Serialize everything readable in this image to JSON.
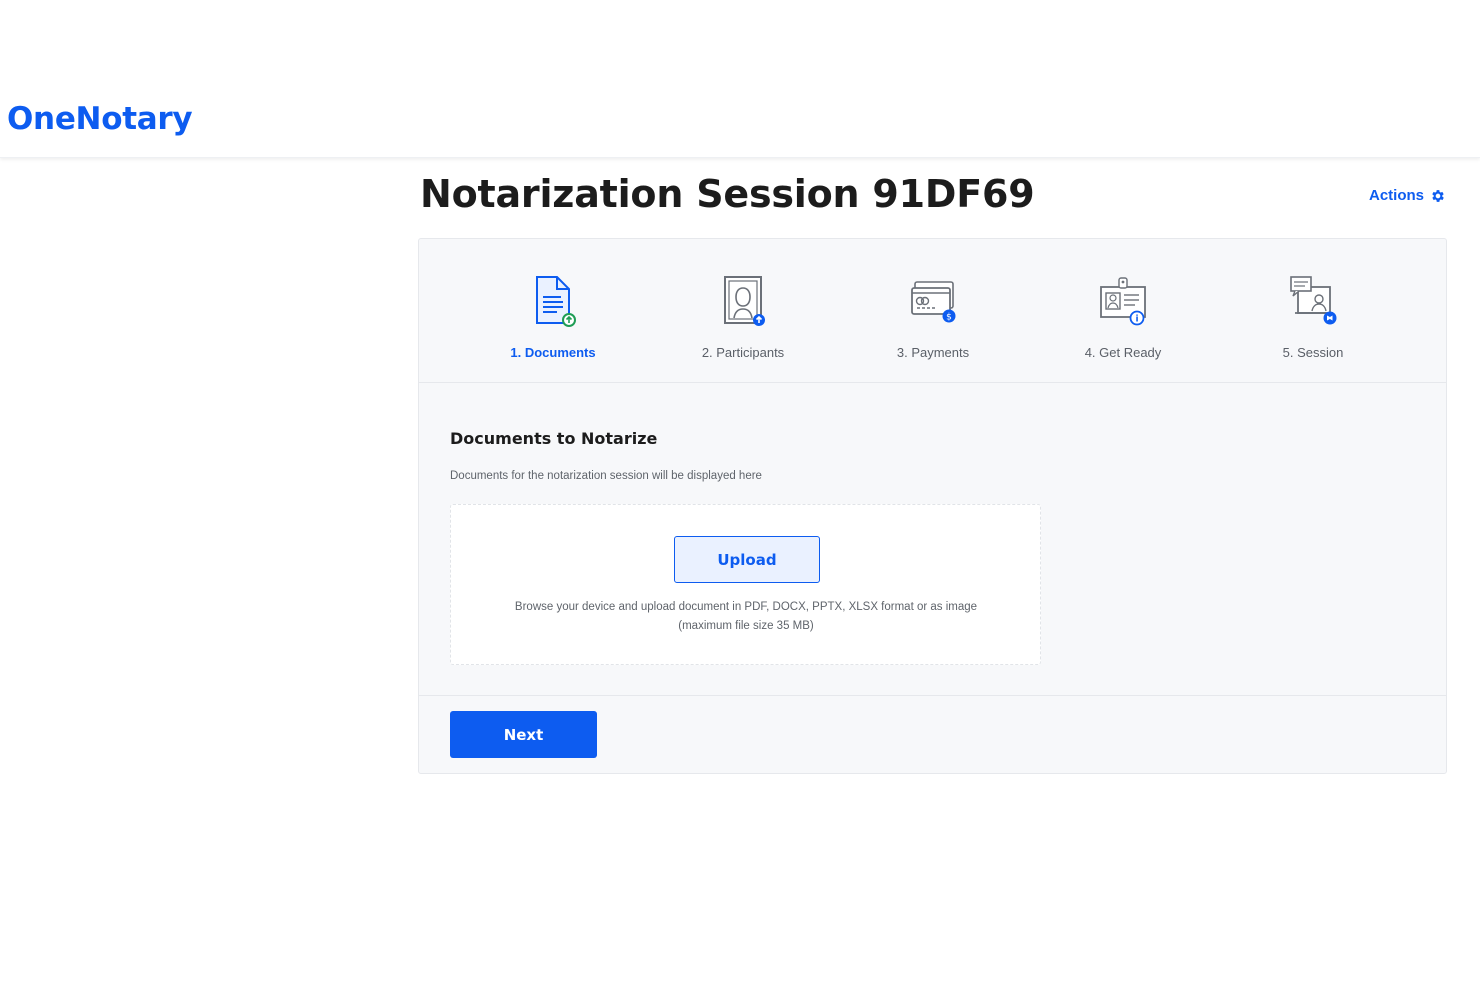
{
  "brand": {
    "name": "OneNotary"
  },
  "header": {
    "title": "Notarization Session 91DF69",
    "actions_label": "Actions"
  },
  "steps": [
    {
      "label": "1. Documents",
      "icon": "document-upload-icon",
      "active": true
    },
    {
      "label": "2. Participants",
      "icon": "participant-upload-icon",
      "active": false
    },
    {
      "label": "3. Payments",
      "icon": "payment-card-icon",
      "active": false
    },
    {
      "label": "4. Get Ready",
      "icon": "id-card-info-icon",
      "active": false
    },
    {
      "label": "5. Session",
      "icon": "video-session-icon",
      "active": false
    }
  ],
  "documents": {
    "title": "Documents to Notarize",
    "subtitle": "Documents for the notarization session will be displayed here",
    "upload_label": "Upload",
    "upload_help": "Browse your device and upload document in PDF, DOCX, PPTX, XLSX format or as image (maximum file size 35 MB)"
  },
  "footer": {
    "next_label": "Next"
  },
  "colors": {
    "accent": "#0d5cf0",
    "success": "#1f9d55",
    "background": "#f7f8fa"
  }
}
